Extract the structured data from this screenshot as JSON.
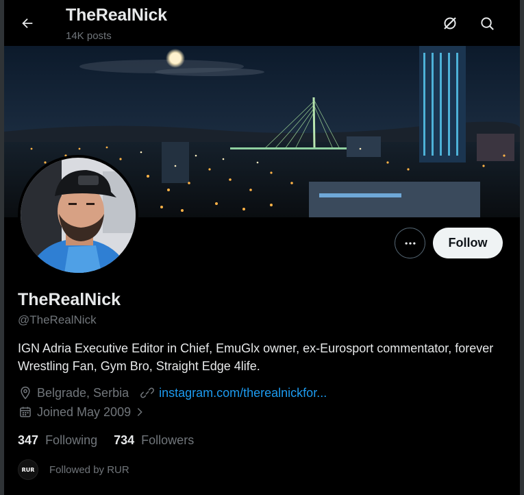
{
  "header": {
    "title": "TheRealNick",
    "posts": "14K posts"
  },
  "profile": {
    "display_name": "TheRealNick",
    "handle": "@TheRealNick",
    "bio": "IGN Adria Executive Editor in Chief, EmuGlx owner, ex-Eurosport commentator, forever Wrestling Fan, Gym Bro, Straight Edge 4life.",
    "location": "Belgrade, Serbia",
    "website": "instagram.com/therealnickfor...",
    "joined": "Joined May 2009",
    "following_count": "347",
    "following_label": "Following",
    "followers_count": "734",
    "followers_label": "Followers",
    "followed_by": "Followed by RUR",
    "followed_by_avatar_text": "RUR"
  },
  "actions": {
    "follow_label": "Follow",
    "more_icon": "more-horizontal-icon"
  },
  "icons": {
    "back": "arrow-left-icon",
    "grok": "grok-icon",
    "search": "search-icon",
    "location": "location-pin-icon",
    "link": "link-icon",
    "calendar": "calendar-icon",
    "chevron": "chevron-right-icon"
  },
  "colors": {
    "background": "#000000",
    "text": "#e7e9ea",
    "muted": "#71767b",
    "link": "#1d9bf0",
    "follow_bg": "#eff3f4"
  }
}
